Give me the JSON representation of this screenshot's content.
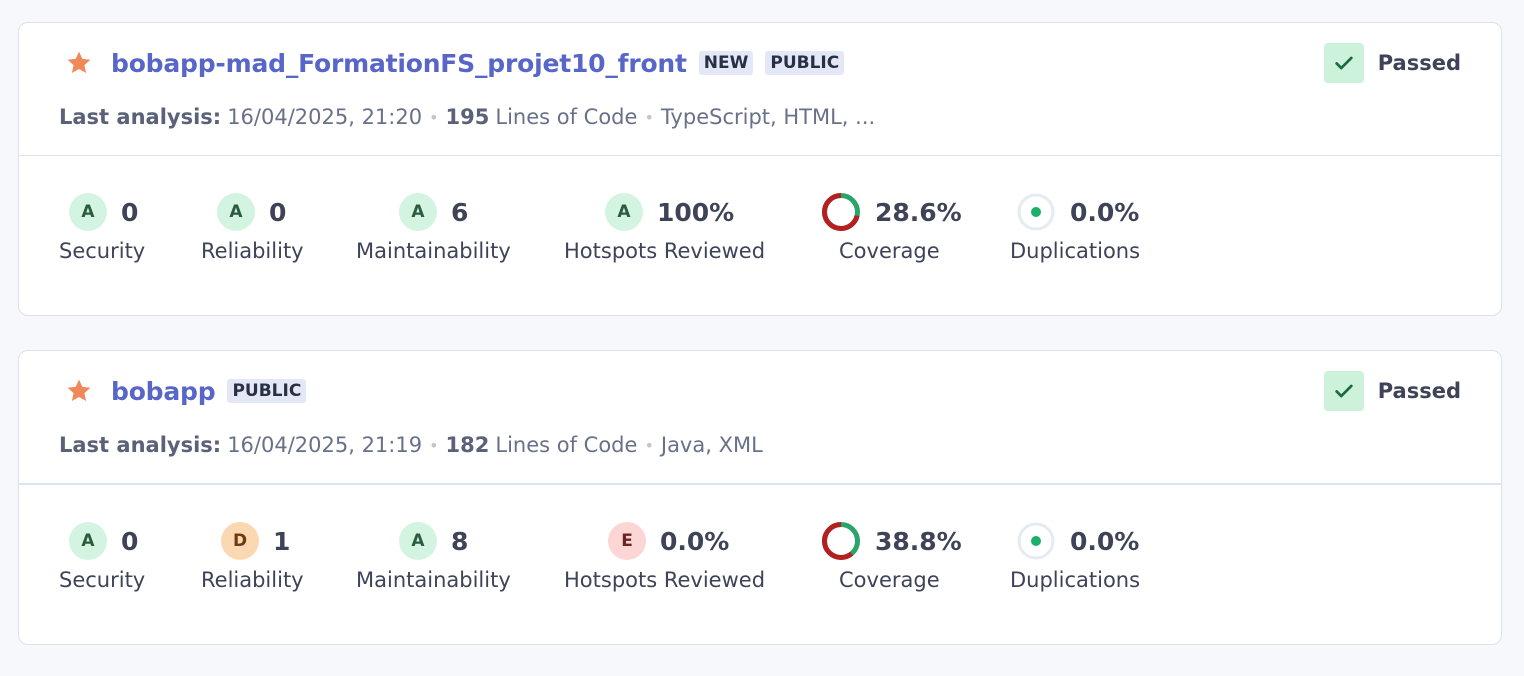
{
  "colors": {
    "link": "#5866c8",
    "star": "#f0895a",
    "passed_bg": "#ccf2dc",
    "passed_check": "#1e6a3f",
    "rating_A": "#d3f4e0",
    "rating_D": "#fcd8b2",
    "rating_E": "#fcd5d5",
    "coverage_good": "#b51f1f",
    "coverage_track": "#2ba46a",
    "duplication_dot": "#1bb06a"
  },
  "projects": [
    {
      "name": "bobapp-mad_FormationFS_projet10_front",
      "favorite_icon": "star-icon",
      "tags": [
        "NEW",
        "PUBLIC"
      ],
      "quality_gate": {
        "icon": "check-icon",
        "label": "Passed"
      },
      "analysis_label": "Last analysis:",
      "analysis_date": "16/04/2025, 21:20",
      "loc": "195",
      "loc_label": "Lines of Code",
      "languages": "TypeScript, HTML, ...",
      "measures": {
        "security": {
          "rating": "A",
          "value": "0",
          "label": "Security"
        },
        "reliability": {
          "rating": "A",
          "value": "0",
          "label": "Reliability"
        },
        "maintainability": {
          "rating": "A",
          "value": "6",
          "label": "Maintainability"
        },
        "hotspots": {
          "rating": "A",
          "value": "100%",
          "label": "Hotspots Reviewed"
        },
        "coverage": {
          "value": "28.6%",
          "percent": 28.6,
          "label": "Coverage"
        },
        "duplications": {
          "value": "0.0%",
          "label": "Duplications"
        }
      }
    },
    {
      "name": "bobapp",
      "favorite_icon": "star-icon",
      "tags": [
        "PUBLIC"
      ],
      "quality_gate": {
        "icon": "check-icon",
        "label": "Passed"
      },
      "analysis_label": "Last analysis:",
      "analysis_date": "16/04/2025, 21:19",
      "loc": "182",
      "loc_label": "Lines of Code",
      "languages": "Java, XML",
      "measures": {
        "security": {
          "rating": "A",
          "value": "0",
          "label": "Security"
        },
        "reliability": {
          "rating": "D",
          "value": "1",
          "label": "Reliability"
        },
        "maintainability": {
          "rating": "A",
          "value": "8",
          "label": "Maintainability"
        },
        "hotspots": {
          "rating": "E",
          "value": "0.0%",
          "label": "Hotspots Reviewed"
        },
        "coverage": {
          "value": "38.8%",
          "percent": 38.8,
          "label": "Coverage"
        },
        "duplications": {
          "value": "0.0%",
          "label": "Duplications"
        }
      }
    }
  ]
}
